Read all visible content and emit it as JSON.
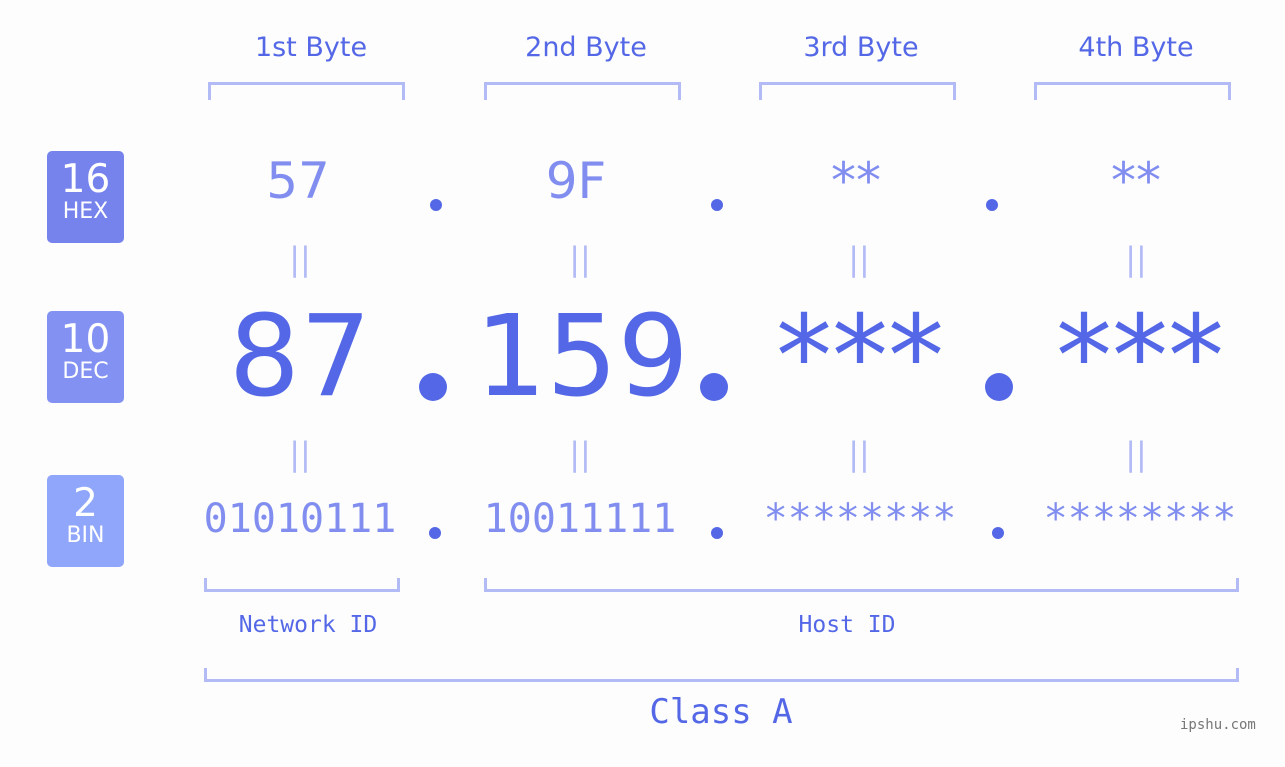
{
  "headers": [
    "1st Byte",
    "2nd Byte",
    "3rd Byte",
    "4th Byte"
  ],
  "rows": {
    "hex": {
      "base": "16",
      "label": "HEX",
      "color": "#7783ec",
      "values": [
        "57",
        "9F",
        "**",
        "**"
      ]
    },
    "dec": {
      "base": "10",
      "label": "DEC",
      "color": "#8392f2",
      "values": [
        "87",
        "159",
        "***",
        "***"
      ]
    },
    "bin": {
      "base": "2",
      "label": "BIN",
      "color": "#8fa6fa",
      "values": [
        "01010111",
        "10011111",
        "********",
        "********"
      ]
    }
  },
  "equals_symbol": "||",
  "separator": ".",
  "network_id_label": "Network ID",
  "host_id_label": "Host ID",
  "class_label": "Class A",
  "watermark": "ipshu.com",
  "colors": {
    "primary": "#5468e7",
    "light": "#818ef0",
    "bracket": "#b2bbf6"
  }
}
